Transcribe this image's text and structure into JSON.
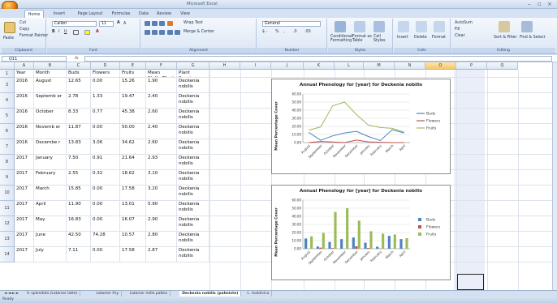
{
  "window": {
    "title": "Microsoft Excel"
  },
  "tabs": [
    "Home",
    "Insert",
    "Page Layout",
    "Formulas",
    "Data",
    "Review",
    "View"
  ],
  "ribbon": {
    "clipboard": {
      "paste": "Paste",
      "cut": "Cut",
      "copy": "Copy",
      "format_painter": "Format Painter",
      "title": "Clipboard"
    },
    "font": {
      "name": "Calibri",
      "size": "11",
      "title": "Font"
    },
    "alignment": {
      "wrap": "Wrap Text",
      "merge": "Merge & Center",
      "title": "Alignment"
    },
    "number": {
      "format": "General",
      "title": "Number"
    },
    "styles": {
      "conditional": "Conditional Formatting",
      "format_table": "Format as Table",
      "cell_styles": "Cell Styles",
      "title": "Styles"
    },
    "cells": {
      "insert": "Insert",
      "delete": "Delete",
      "format": "Format",
      "title": "Cells"
    },
    "editing": {
      "autosum": "AutoSum",
      "fill": "Fill",
      "clear": "Clear",
      "sort": "Sort & Filter",
      "find": "Find & Select",
      "title": "Editing"
    }
  },
  "formula_bar": {
    "namebox": "O11",
    "fx": "fx",
    "value": ""
  },
  "columns": [
    "A",
    "B",
    "C",
    "D",
    "E",
    "F",
    "G",
    "H",
    "I",
    "J",
    "K",
    "L",
    "M",
    "N",
    "O",
    "P",
    "Q"
  ],
  "headers": [
    "Year",
    "Month",
    "Buds",
    "Flowers",
    "Fruits",
    "Mean Stalks/Plant",
    "Plant Species"
  ],
  "rows": [
    {
      "n": "1",
      "cells": [
        "Year",
        "Month",
        "Buds",
        "Flowers",
        "Fruits",
        "Mean Stalks/Plant",
        "Plant Species"
      ]
    },
    {
      "n": "3",
      "cells": [
        "2016",
        "August",
        "12.65",
        "0.00",
        "15.26",
        "1.90",
        "Deckenia nobilis"
      ]
    },
    {
      "n": "4",
      "cells": [
        "2016",
        "Septemb er",
        "2.78",
        "1.33",
        "19.47",
        "2.40",
        "Deckenia nobilis"
      ]
    },
    {
      "n": "5",
      "cells": [
        "2016",
        "October",
        "8.33",
        "0.77",
        "45.38",
        "2.60",
        "Deckenia nobilis"
      ]
    },
    {
      "n": "6",
      "cells": [
        "2016",
        "Novemb er",
        "11.87",
        "0.00",
        "50.00",
        "2.40",
        "Deckenia nobilis"
      ]
    },
    {
      "n": "7",
      "cells": [
        "2016",
        "Decembe r",
        "13.83",
        "3.06",
        "34.62",
        "2.60",
        "Deckenia nobilis"
      ]
    },
    {
      "n": "8",
      "cells": [
        "2017",
        "January",
        "7.50",
        "0.91",
        "21.64",
        "2.93",
        "Deckenia nobilis"
      ]
    },
    {
      "n": "9",
      "cells": [
        "2017",
        "February",
        "2.55",
        "0.32",
        "18.62",
        "3.10",
        "Deckenia nobilis"
      ]
    },
    {
      "n": "10",
      "cells": [
        "2017",
        "March",
        "15.85",
        "0.00",
        "17.58",
        "3.20",
        "Deckenia nobilis"
      ]
    },
    {
      "n": "11",
      "cells": [
        "2017",
        "April",
        "11.90",
        "0.00",
        "13.01",
        "5.90",
        "Deckenia nobilis"
      ]
    },
    {
      "n": "12",
      "cells": [
        "2017",
        "May",
        "16.83",
        "0.00",
        "16.07",
        "2.90",
        "Deckenia nobilis"
      ]
    },
    {
      "n": "13",
      "cells": [
        "2017",
        "June",
        "42.50",
        "74.28",
        "10.57",
        "2.80",
        "Deckenia nobilis"
      ]
    },
    {
      "n": "14",
      "cells": [
        "2017",
        "July",
        "7.11",
        "0.00",
        "17.58",
        "2.87",
        "Deckenia nobilis"
      ]
    }
  ],
  "charts": [
    {
      "title": "Annual Phenology for [year] for Deckenia nobilis",
      "ylabel": "Mean Percentage Cover",
      "type": "line"
    },
    {
      "title": "Annual Phenology for [year] for Deckenia nobilis",
      "ylabel": "Mean Percentage Cover",
      "type": "bar"
    }
  ],
  "chart_data": [
    {
      "type": "line",
      "title": "Annual Phenology for [year] for Deckenia nobilis",
      "ylabel": "Mean Percentage Cover",
      "ylim": [
        0,
        60
      ],
      "yticks": [
        "0.00",
        "10.00",
        "20.00",
        "30.00",
        "40.00",
        "50.00",
        "60.00"
      ],
      "categories": [
        "August",
        "September",
        "October",
        "November",
        "December",
        "January",
        "February",
        "March",
        "April"
      ],
      "series": [
        {
          "name": "Buds",
          "color": "#4f81bd",
          "values": [
            12.65,
            2.78,
            8.33,
            11.87,
            13.83,
            7.5,
            2.55,
            15.85,
            11.9
          ]
        },
        {
          "name": "Flowers",
          "color": "#c0504d",
          "values": [
            0,
            1.33,
            0.77,
            0,
            3.06,
            0.91,
            0.32,
            0,
            0
          ]
        },
        {
          "name": "Fruits",
          "color": "#9bbb59",
          "values": [
            15.26,
            19.47,
            45.38,
            50.0,
            34.62,
            21.64,
            18.62,
            17.58,
            13.01
          ]
        }
      ],
      "legend": "right"
    },
    {
      "type": "bar",
      "title": "Annual Phenology for [year] for Deckenia nobilis",
      "ylabel": "Mean Percentage Cover",
      "ylim": [
        0,
        60
      ],
      "yticks": [
        "0.00",
        "10.00",
        "20.00",
        "30.00",
        "40.00",
        "50.00",
        "60.00"
      ],
      "categories": [
        "August",
        "September",
        "October",
        "November",
        "December",
        "January",
        "February",
        "March",
        "April"
      ],
      "series": [
        {
          "name": "Buds",
          "color": "#4f81bd",
          "values": [
            12.65,
            2.78,
            8.33,
            11.87,
            13.83,
            7.5,
            2.55,
            15.85,
            11.9
          ]
        },
        {
          "name": "Flowers",
          "color": "#c0504d",
          "values": [
            0,
            1.33,
            0.77,
            0,
            3.06,
            0.91,
            0.32,
            0,
            0
          ]
        },
        {
          "name": "Fruits",
          "color": "#9bbb59",
          "values": [
            15.26,
            19.47,
            45.38,
            50.0,
            34.62,
            21.64,
            18.62,
            17.58,
            13.01
          ]
        }
      ],
      "legend": "right"
    }
  ],
  "sheet_tabs": [
    "V. splendida (Latanier latte)",
    "Latanier Fey",
    "Latanier mille pattes",
    "Deckenia nobilis (palmiste)",
    "L. maldivica"
  ],
  "active_sheet": "Deckenia nobilis (palmiste)",
  "status": "Ready"
}
